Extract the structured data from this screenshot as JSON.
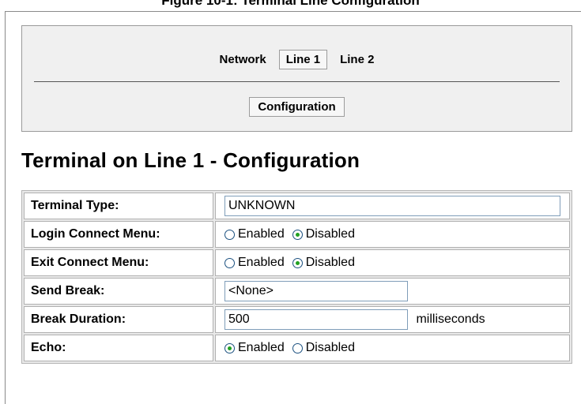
{
  "header": {
    "clipped_title": "Figure 10-1: Terminal Line Configuration"
  },
  "nav": {
    "tabs": [
      {
        "label": "Network",
        "active": false
      },
      {
        "label": "Line 1",
        "active": true
      },
      {
        "label": "Line 2",
        "active": false
      }
    ],
    "sub_tab": "Configuration"
  },
  "page": {
    "title": "Terminal on Line 1 - Configuration"
  },
  "form": {
    "terminal_type": {
      "label": "Terminal Type:",
      "value": "UNKNOWN"
    },
    "login_connect_menu": {
      "label": "Login Connect Menu:",
      "options": [
        "Enabled",
        "Disabled"
      ],
      "selected": "Disabled"
    },
    "exit_connect_menu": {
      "label": "Exit Connect Menu:",
      "options": [
        "Enabled",
        "Disabled"
      ],
      "selected": "Disabled"
    },
    "send_break": {
      "label": "Send Break:",
      "value": "<None>"
    },
    "break_duration": {
      "label": "Break Duration:",
      "value": "500",
      "unit": "milliseconds"
    },
    "echo": {
      "label": "Echo:",
      "options": [
        "Enabled",
        "Disabled"
      ],
      "selected": "Enabled"
    }
  },
  "colors": {
    "panel_bg": "#f0f0f0",
    "radio_dot": "#21a121",
    "input_border": "#7f9db9"
  }
}
